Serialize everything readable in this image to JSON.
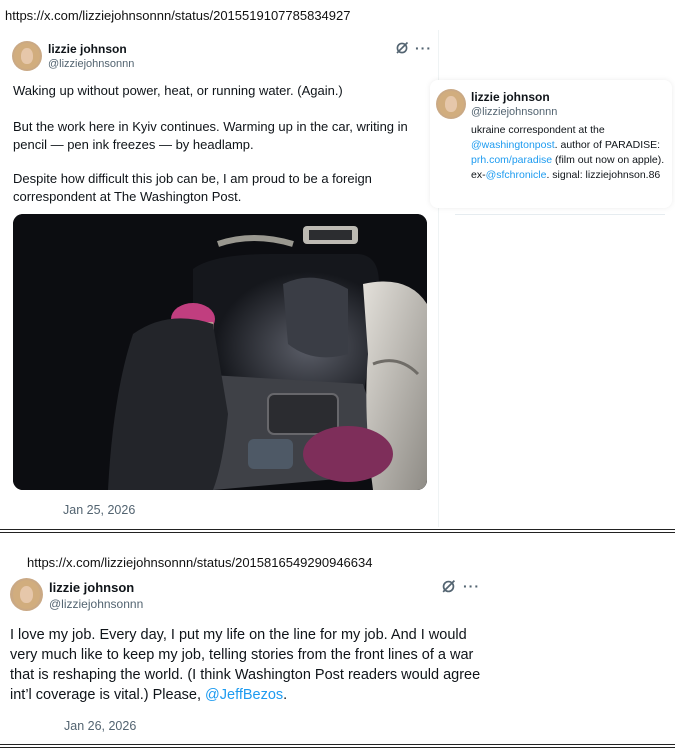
{
  "tweet1": {
    "url": "https://x.com/lizziejohnsonnn/status/2015519107785834927",
    "author": {
      "name": "lizzie johnson",
      "handle": "@lizziejohnsonnn"
    },
    "paragraphs": [
      "Waking up without power, heat, or running water. (Again.)",
      "But the work here in Kyiv continues. Warming up in the car, writing in pencil — pen ink freezes — by headlamp.",
      "Despite how difficult this job can be, I am proud to be a foreign correspondent at The Washington Post."
    ],
    "date": "Jan 25, 2026"
  },
  "profile_card": {
    "name": "lizzie johnson",
    "handle": "@lizziejohnsonnn",
    "bio": {
      "p1": "ukraine correspondent at the ",
      "link1": "@washingtonpost",
      "p2": ". author of PARADISE: ",
      "link2": "prh.com/paradise",
      "p3": " (film out now on apple). ex-",
      "link3": "@sfchronicle",
      "p4": ". signal: lizziejohnson.86"
    }
  },
  "tweet2": {
    "url": "https://x.com/lizziejohnsonnn/status/2015816549290946634",
    "author": {
      "name": "lizzie johnson",
      "handle": "@lizziejohnsonnn"
    },
    "text": "I love my job. Every day, I put my life on the line for my job. And I would very much like to keep my job, telling stories from the front lines of a war that is reshaping the world. (I think Washington Post readers would agree int’l coverage is vital.) Please, ",
    "mention": "@JeffBezos",
    "text_end": ".",
    "date": "Jan 26, 2026"
  },
  "icons": {
    "grok": "grok-icon",
    "more": "more-icon"
  },
  "colors": {
    "link": "#1d9bf0",
    "secondary": "#536471",
    "text": "#0f1419"
  }
}
